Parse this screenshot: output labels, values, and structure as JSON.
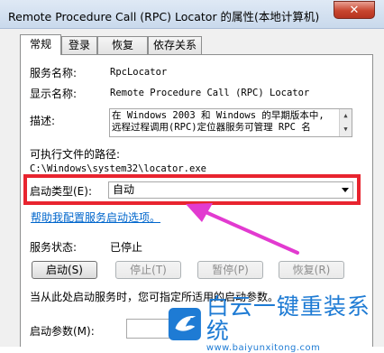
{
  "window": {
    "title": "Remote Procedure Call (RPC) Locator 的属性(本地计算机)",
    "close_label": "✕"
  },
  "tabs": [
    {
      "label": "常规",
      "active": true
    },
    {
      "label": "登录"
    },
    {
      "label": "恢复"
    },
    {
      "label": "依存关系"
    }
  ],
  "general": {
    "service_name_label": "服务名称:",
    "service_name_value": "RpcLocator",
    "display_name_label": "显示名称:",
    "display_name_value": "Remote Procedure Call (RPC) Locator",
    "description_label": "描述:",
    "description_line1": "在 Windows 2003 和 Windows 的早期版本中,",
    "description_line2": "远程过程调用(RPC)定位器服务可管理 RPC 名",
    "exe_path_label": "可执行文件的路径:",
    "exe_path_value": "C:\\Windows\\system32\\locator.exe",
    "startup_type_label": "启动类型(E):",
    "startup_type_value": "自动",
    "help_link": "帮助我配置服务启动选项。",
    "status_label": "服务状态:",
    "status_value": "已停止",
    "start_button": "启动(S)",
    "stop_button": "停止(T)",
    "pause_button": "暂停(P)",
    "resume_button": "恢复(R)",
    "start_params_hint": "当从此处启动服务时，您可指定所适用的启动参数。",
    "start_params_label": "启动参数(M):"
  },
  "watermark": {
    "text": "白云一键重装系统",
    "url": "www.baiyunxitong.com"
  },
  "colors": {
    "highlight": "#e8242f",
    "arrow": "#e23ad0",
    "link": "#0066cc",
    "watermark": "#1e7bd4"
  }
}
